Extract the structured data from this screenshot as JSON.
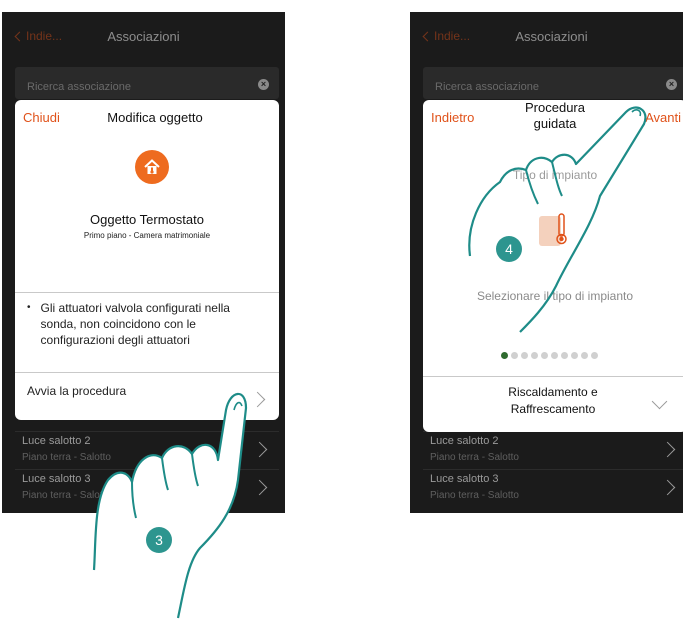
{
  "left_screen": {
    "nav": {
      "back_label": "Indie...",
      "title": "Associazioni"
    },
    "search": {
      "placeholder": "Ricerca associazione",
      "clear_icon": "clear-circle-icon"
    },
    "list": [
      {
        "name": "Luce salotto 2",
        "location": "Piano terra - Salotto"
      },
      {
        "name": "Luce salotto 3",
        "location": "Piano terra - Salotto"
      }
    ],
    "modal": {
      "close_label": "Chiudi",
      "title": "Modifica oggetto",
      "object_icon": "thermostat-house-icon",
      "object_name": "Oggetto Termostato",
      "object_location": "Primo piano - Camera matrimoniale",
      "warning_bullet": "•",
      "warning_text": "Gli attuatori valvola configurati nella sonda, non coincidono con le configurazioni degli attuatori",
      "start_button_label": "Avvia la procedura"
    },
    "step_number": "3"
  },
  "right_screen": {
    "nav": {
      "back_label": "Indie...",
      "title": "Associazioni"
    },
    "search": {
      "placeholder": "Ricerca associazione"
    },
    "list": [
      {
        "name": "Luce salotto 2",
        "location": "Piano terra - Salotto"
      },
      {
        "name": "Luce salotto 3",
        "location": "Piano terra - Salotto"
      }
    ],
    "modal": {
      "back_label": "Indietro",
      "title": "Procedura guidata",
      "next_label": "Avanti",
      "type_heading": "Tipo di impianto",
      "instruction": "Selezionare il tipo di impianto",
      "page_total": 10,
      "page_current": 1,
      "selected_value": "Riscaldamento e Raffrescamento"
    },
    "step_number": "4"
  },
  "colors": {
    "accent": "#e0521a",
    "badge": "#2d958f",
    "active_dot": "#2f6b2f",
    "screen_bg": "#1b1b1b"
  }
}
